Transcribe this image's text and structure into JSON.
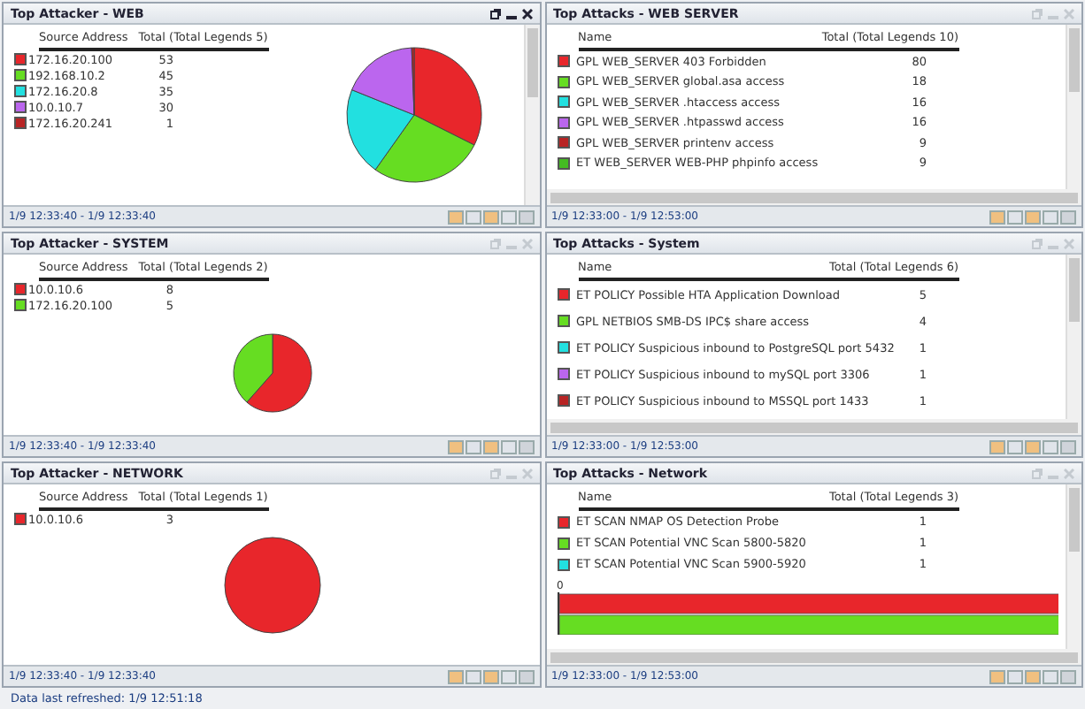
{
  "panels": [
    {
      "kind": "pie-side",
      "title": "Top Attacker - WEB",
      "active": true,
      "vertical_scrollbar": true,
      "col_name": "Source Address",
      "col_total": "Total (Total Legends 5)",
      "range": "1/9 12:33:40 - 1/9 12:33:40",
      "rows": [
        {
          "name": "172.16.20.100",
          "total": "53",
          "color": "#e8262b"
        },
        {
          "name": "192.168.10.2",
          "total": "45",
          "color": "#66dd22"
        },
        {
          "name": "172.16.20.8",
          "total": "35",
          "color": "#22e0e0"
        },
        {
          "name": "10.0.10.7",
          "total": "30",
          "color": "#bb66ee"
        },
        {
          "name": "172.16.20.241",
          "total": "1",
          "color": "#b82424"
        }
      ],
      "chart_data": {
        "type": "pie",
        "values": [
          32.4,
          27.4,
          21.3,
          18.3,
          0.6
        ]
      }
    },
    {
      "kind": "list",
      "title": "Top Attacks - WEB SERVER",
      "active": false,
      "vertical_scrollbar": true,
      "col_name": "Name",
      "col_total": "Total (Total Legends 10)",
      "range": "1/9 12:33:00 - 1/9 12:53:00",
      "rows": [
        {
          "name": "GPL WEB_SERVER 403 Forbidden",
          "total": "80",
          "color": "#e8262b"
        },
        {
          "name": "GPL WEB_SERVER global.asa access",
          "total": "18",
          "color": "#66dd22"
        },
        {
          "name": "GPL WEB_SERVER .htaccess access",
          "total": "16",
          "color": "#22e0e0"
        },
        {
          "name": "GPL WEB_SERVER .htpasswd access",
          "total": "16",
          "color": "#bb66ee"
        },
        {
          "name": "GPL WEB_SERVER printenv access",
          "total": "9",
          "color": "#b82424"
        },
        {
          "name": "ET WEB_SERVER WEB-PHP phpinfo access",
          "total": "9",
          "color": "#44bb22"
        }
      ]
    },
    {
      "kind": "pie-below",
      "title": "Top Attacker - SYSTEM",
      "active": false,
      "vertical_scrollbar": false,
      "col_name": "Source Address",
      "col_total": "Total (Total Legends 2)",
      "range": "1/9 12:33:40 - 1/9 12:33:40",
      "rows": [
        {
          "name": "10.0.10.6",
          "total": "8",
          "color": "#e8262b"
        },
        {
          "name": "172.16.20.100",
          "total": "5",
          "color": "#66dd22"
        }
      ],
      "chart_data": {
        "type": "pie",
        "values": [
          61.5,
          38.5
        ]
      }
    },
    {
      "kind": "list",
      "title": "Top Attacks - System",
      "active": false,
      "vertical_scrollbar": true,
      "col_name": "Name",
      "col_total": "Total (Total Legends 6)",
      "range": "1/9 12:33:00 - 1/9 12:53:00",
      "rows": [
        {
          "name": "ET POLICY Possible HTA Application Download",
          "total": "5",
          "color": "#e8262b"
        },
        {
          "name": "GPL NETBIOS SMB-DS IPC$ share access",
          "total": "4",
          "color": "#66dd22"
        },
        {
          "name": "ET POLICY Suspicious inbound to PostgreSQL port 5432",
          "total": "1",
          "color": "#22e0e0"
        },
        {
          "name": "ET POLICY Suspicious inbound to mySQL port 3306",
          "total": "1",
          "color": "#bb66ee"
        },
        {
          "name": "ET POLICY Suspicious inbound to MSSQL port 1433",
          "total": "1",
          "color": "#b82424"
        }
      ]
    },
    {
      "kind": "pie-below",
      "title": "Top Attacker - NETWORK",
      "active": false,
      "vertical_scrollbar": false,
      "col_name": "Source Address",
      "col_total": "Total (Total Legends 1)",
      "range": "1/9 12:33:40 - 1/9 12:33:40",
      "rows": [
        {
          "name": "10.0.10.6",
          "total": "3",
          "color": "#e8262b"
        }
      ],
      "chart_data": {
        "type": "pie",
        "values": [
          100
        ]
      }
    },
    {
      "kind": "list-bars",
      "title": "Top Attacks - Network",
      "active": false,
      "vertical_scrollbar": true,
      "col_name": "Name",
      "col_total": "Total (Total Legends 3)",
      "range": "1/9 12:33:00 - 1/9 12:53:00",
      "axis_label": "0",
      "rows": [
        {
          "name": "ET SCAN NMAP OS Detection Probe",
          "total": "1",
          "color": "#e8262b"
        },
        {
          "name": "ET SCAN Potential VNC Scan 5800-5820",
          "total": "1",
          "color": "#66dd22"
        },
        {
          "name": "ET SCAN Potential VNC Scan 5900-5920",
          "total": "1",
          "color": "#22e0e0"
        }
      ]
    }
  ],
  "status": "Data last refreshed: 1/9 12:51:18"
}
